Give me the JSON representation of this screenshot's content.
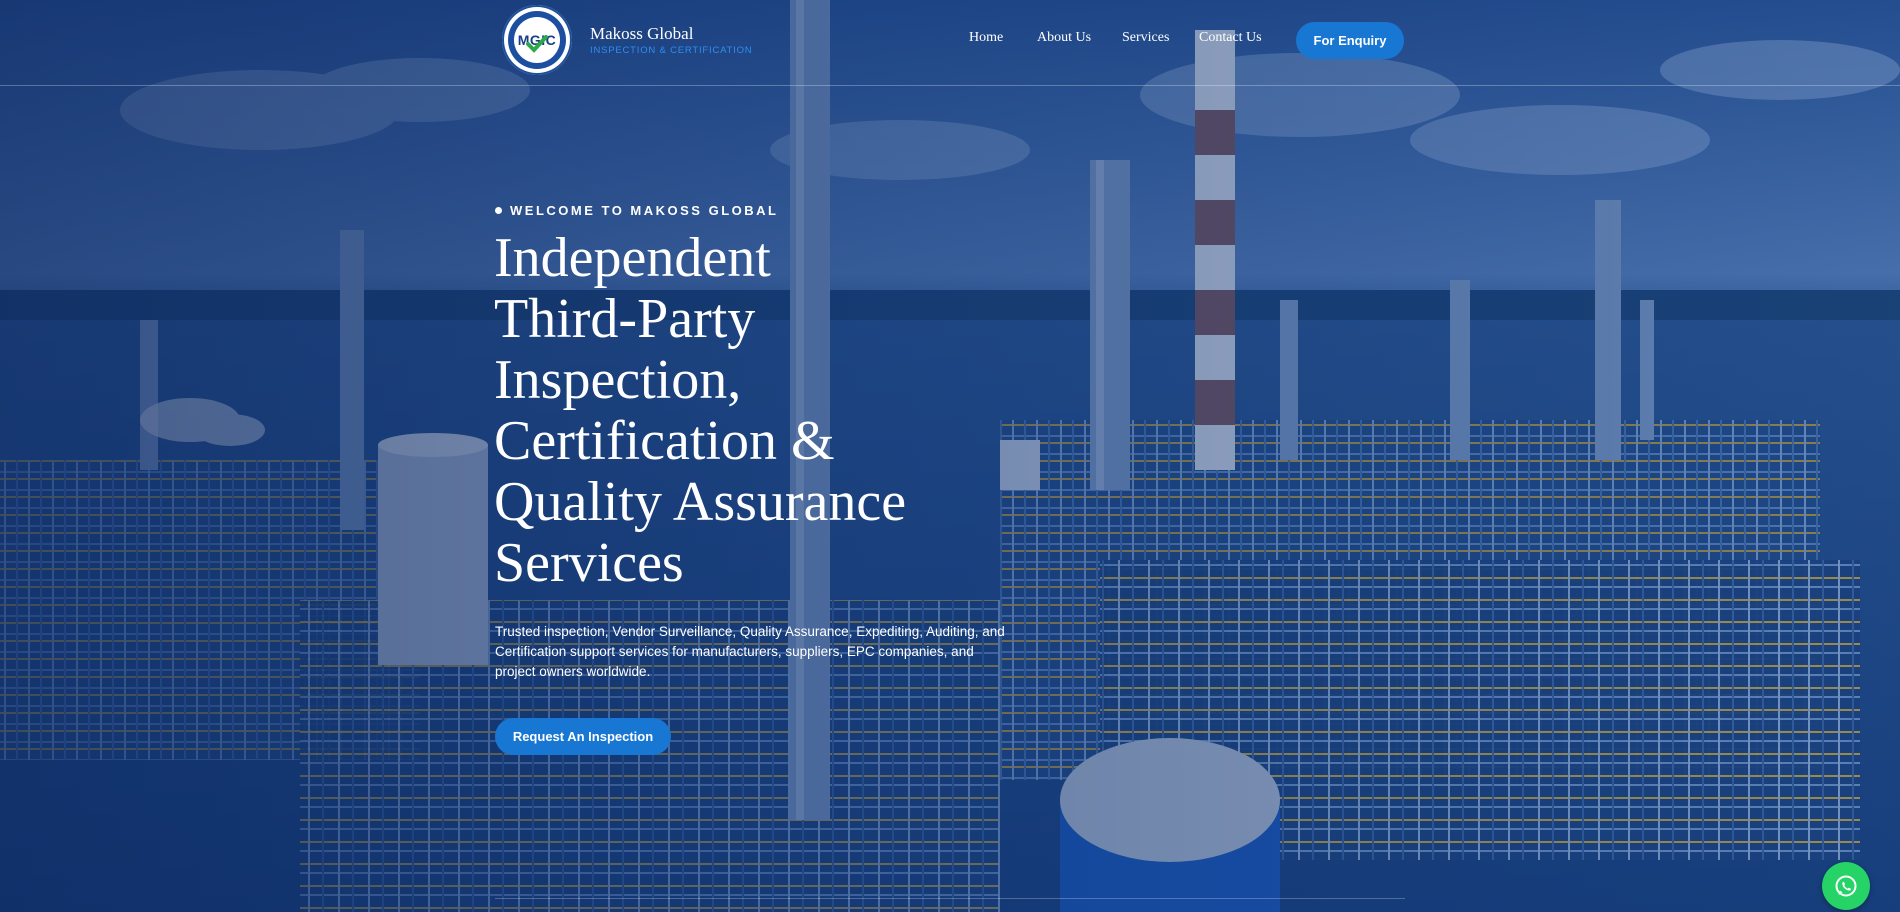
{
  "header": {
    "logo_text": "MGIC",
    "brand_name": "Makoss Global",
    "brand_tagline": "INSPECTION & CERTIFICATION",
    "nav": [
      {
        "label": "Home"
      },
      {
        "label": "About Us"
      },
      {
        "label": "Services"
      },
      {
        "label": "Contact Us"
      }
    ],
    "enquiry_label": "For Enquiry"
  },
  "hero": {
    "eyebrow": "WELCOME TO MAKOSS GLOBAL",
    "title_lines": [
      "Independent",
      "Third-Party",
      "Inspection,",
      "Certification &",
      "Quality Assurance",
      "Services"
    ],
    "description": "Trusted inspection, Vendor Surveillance, Quality Assurance, Expediting, Auditing, and Certification support services for manufacturers, suppliers, EPC companies, and project owners worldwide.",
    "cta_label": "Request An Inspection"
  },
  "floating": {
    "whatsapp_icon": "whatsapp-icon"
  },
  "colors": {
    "accent": "#1877d3",
    "tagline": "#2f8df0",
    "whatsapp": "#25d366",
    "overlay": "#0a2860"
  }
}
